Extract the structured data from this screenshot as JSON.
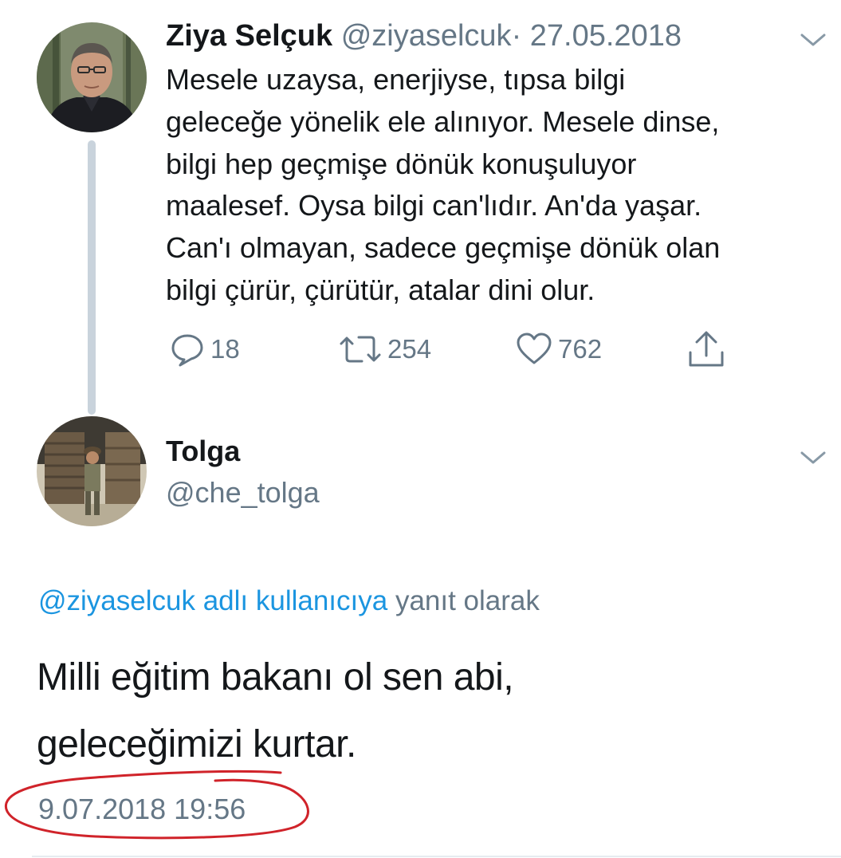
{
  "original_tweet": {
    "display_name": "Ziya Selçuk",
    "handle": "@ziyaselcuk",
    "separator": "·",
    "date": "27.05.2018",
    "text_lines": [
      "Mesele uzaysa, enerjiyse, tıpsa bilgi",
      "geleceğe yönelik ele alınıyor. Mesele dinse,",
      "bilgi hep geçmişe dönük konuşuluyor",
      "maalesef. Oysa bilgi can'lıdır. An'da yaşar.",
      "Can'ı olmayan, sadece geçmişe dönük olan",
      "bilgi çürür, çürütür, atalar dini olur."
    ],
    "actions": {
      "reply_count": "18",
      "retweet_count": "254",
      "like_count": "762"
    }
  },
  "reply_tweet": {
    "display_name": "Tolga",
    "handle": "@che_tolga",
    "reply_context_mention": "@ziyaselcuk adlı kullanıcıya",
    "reply_context_suffix": " yanıt olarak",
    "text_lines": [
      "Milli eğitim bakanı ol sen abi,",
      "geleceğimizi kurtar."
    ],
    "timestamp": "9.07.2018 19:56"
  },
  "icons": {
    "reply": "reply-icon",
    "retweet": "retweet-icon",
    "like": "heart-icon",
    "share": "share-icon",
    "menu": "chevron-down-icon"
  },
  "colors": {
    "primary_text": "#14171a",
    "secondary_text": "#657786",
    "link": "#1b95e0",
    "thread_line": "#c9d3dc",
    "annotation_circle": "#d0232a"
  }
}
